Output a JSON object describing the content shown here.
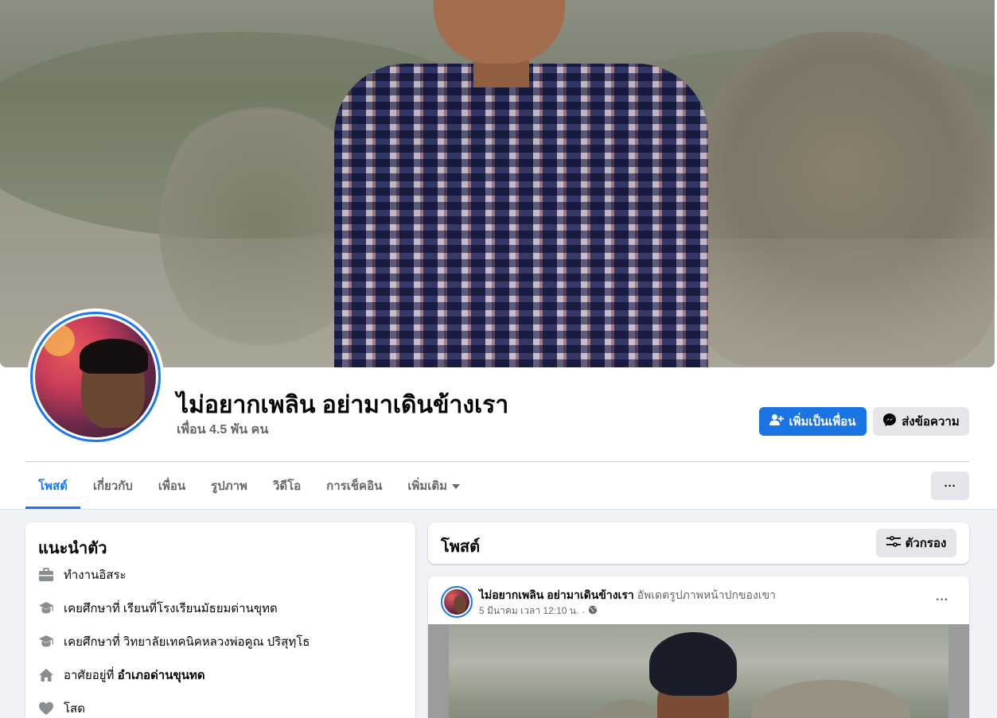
{
  "profile": {
    "name": "ไม่อยากเพลิน อย่ามาเดินข้างเรา",
    "friends": "เพื่อน 4.5 พัน คน",
    "add_friend_label": "เพิ่มเป็นเพื่อน",
    "message_label": "ส่งข้อความ",
    "more_label": "···"
  },
  "tabs": [
    {
      "label": "โพสต์",
      "active": true
    },
    {
      "label": "เกี่ยวกับ"
    },
    {
      "label": "เพื่อน"
    },
    {
      "label": "รูปภาพ"
    },
    {
      "label": "วิดีโอ"
    },
    {
      "label": "การเช็คอิน"
    },
    {
      "label": "เพิ่มเติม"
    }
  ],
  "intro": {
    "title": "แนะนำตัว",
    "items": [
      {
        "icon": "briefcase-icon",
        "text": "ทำงานอิสระ"
      },
      {
        "icon": "graduation-cap-icon",
        "text": "เคยศึกษาที่ เรียนที่โรงเรียนมัธยมด่านขุทด"
      },
      {
        "icon": "graduation-cap-icon",
        "text": "เคยศึกษาที่ วิทยาลัยเทคนิคหลวงพ่อคูณ ปริสุทฺโธ"
      },
      {
        "icon": "home-icon",
        "text_prefix": "อาศัยอยู่ที่ ",
        "text_bold": "อำเภอด่านขุนทด"
      },
      {
        "icon": "heart-icon",
        "text": "โสด"
      }
    ]
  },
  "posts_header": {
    "title": "โพสต์",
    "filter_label": "ตัวกรอง"
  },
  "post": {
    "author": "ไม่อยากเพลิน อย่ามาเดินข้างเรา",
    "action": "อัพเดตรูปภาพหน้าปกของเขา",
    "timestamp": "5 มีนาคม เวลา 12:10 น.",
    "separator": "·",
    "more_label": "···"
  },
  "colors": {
    "accent": "#1877f2",
    "primary_button": "#1b74e4",
    "secondary_button": "#e4e6eb",
    "muted_text": "#65676b",
    "page_bg": "#f0f2f5"
  }
}
